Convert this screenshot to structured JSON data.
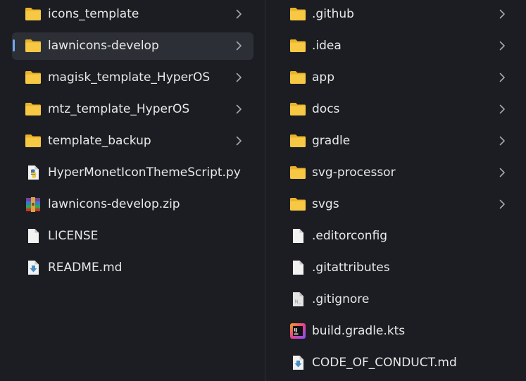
{
  "left_column": {
    "items": [
      {
        "name": "icons_template",
        "type": "folder",
        "selected": false
      },
      {
        "name": "lawnicons-develop",
        "type": "folder",
        "selected": true
      },
      {
        "name": "magisk_template_HyperOS",
        "type": "folder",
        "selected": false
      },
      {
        "name": "mtz_template_HyperOS",
        "type": "folder",
        "selected": false
      },
      {
        "name": "template_backup",
        "type": "folder",
        "selected": false
      },
      {
        "name": "HyperMonetIconThemeScript.py",
        "type": "python-file",
        "selected": false
      },
      {
        "name": "lawnicons-develop.zip",
        "type": "zip-archive",
        "selected": false
      },
      {
        "name": "LICENSE",
        "type": "file",
        "selected": false
      },
      {
        "name": "README.md",
        "type": "markdown-file",
        "selected": false
      }
    ]
  },
  "right_column": {
    "items": [
      {
        "name": ".github",
        "type": "folder"
      },
      {
        "name": ".idea",
        "type": "folder"
      },
      {
        "name": "app",
        "type": "folder"
      },
      {
        "name": "docs",
        "type": "folder"
      },
      {
        "name": "gradle",
        "type": "folder"
      },
      {
        "name": "svg-processor",
        "type": "folder"
      },
      {
        "name": "svgs",
        "type": "folder"
      },
      {
        "name": ".editorconfig",
        "type": "file"
      },
      {
        "name": ".gitattributes",
        "type": "file"
      },
      {
        "name": ".gitignore",
        "type": "text-file"
      },
      {
        "name": "build.gradle.kts",
        "type": "kotlin-file"
      },
      {
        "name": "CODE_OF_CONDUCT.md",
        "type": "markdown-file"
      }
    ]
  },
  "colors": {
    "background": "#1b1d22",
    "selection": "#2c2f35",
    "accent": "#6fa8f5",
    "folder": "#f7c843",
    "text": "#e8e8e8"
  }
}
